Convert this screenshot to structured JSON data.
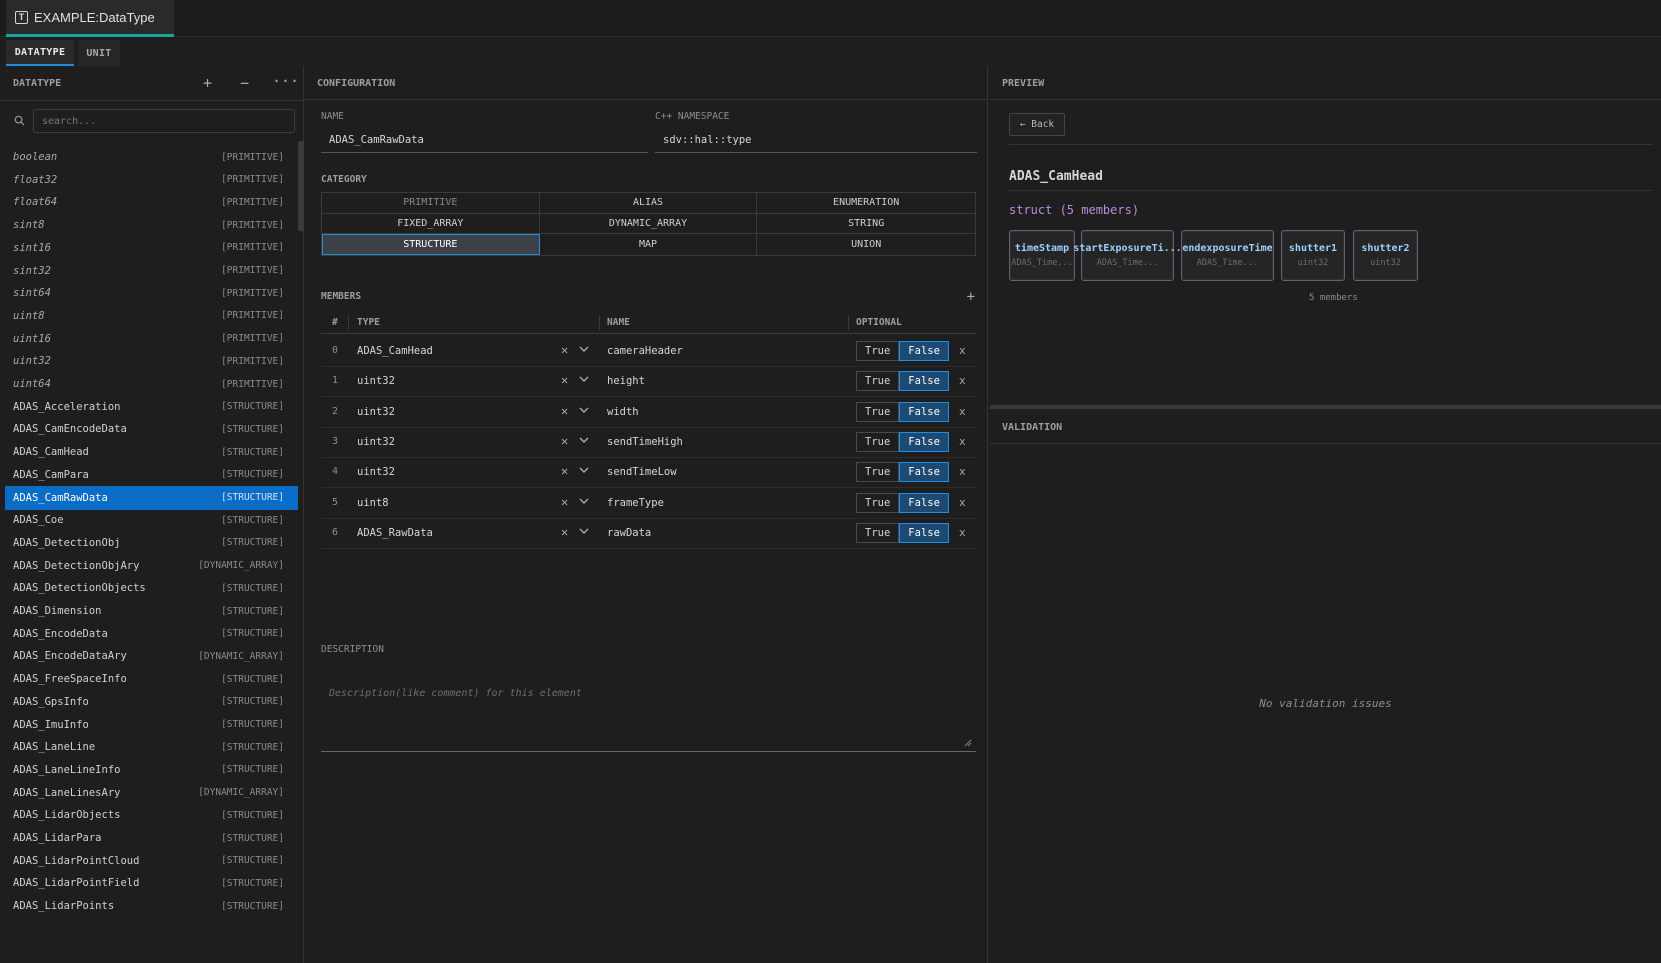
{
  "window": {
    "tab_title": "EXAMPLE:DataType",
    "tab_icon": "type-icon"
  },
  "tabs": [
    {
      "label": "DATATYPE"
    },
    {
      "label": "UNIT"
    }
  ],
  "sidebar": {
    "title": "DATATYPE",
    "add_label": "+",
    "remove_label": "−",
    "more_label": "···",
    "search_placeholder": "search...",
    "items": [
      {
        "name": "boolean",
        "tag": "[PRIMITIVE]"
      },
      {
        "name": "float32",
        "tag": "[PRIMITIVE]"
      },
      {
        "name": "float64",
        "tag": "[PRIMITIVE]"
      },
      {
        "name": "sint8",
        "tag": "[PRIMITIVE]"
      },
      {
        "name": "sint16",
        "tag": "[PRIMITIVE]"
      },
      {
        "name": "sint32",
        "tag": "[PRIMITIVE]"
      },
      {
        "name": "sint64",
        "tag": "[PRIMITIVE]"
      },
      {
        "name": "uint8",
        "tag": "[PRIMITIVE]"
      },
      {
        "name": "uint16",
        "tag": "[PRIMITIVE]"
      },
      {
        "name": "uint32",
        "tag": "[PRIMITIVE]"
      },
      {
        "name": "uint64",
        "tag": "[PRIMITIVE]"
      },
      {
        "name": "ADAS_Acceleration",
        "tag": "[STRUCTURE]"
      },
      {
        "name": "ADAS_CamEncodeData",
        "tag": "[STRUCTURE]"
      },
      {
        "name": "ADAS_CamHead",
        "tag": "[STRUCTURE]"
      },
      {
        "name": "ADAS_CamPara",
        "tag": "[STRUCTURE]"
      },
      {
        "name": "ADAS_CamRawData",
        "tag": "[STRUCTURE]"
      },
      {
        "name": "ADAS_Coe",
        "tag": "[STRUCTURE]"
      },
      {
        "name": "ADAS_DetectionObj",
        "tag": "[STRUCTURE]"
      },
      {
        "name": "ADAS_DetectionObjAry",
        "tag": "[DYNAMIC_ARRAY]"
      },
      {
        "name": "ADAS_DetectionObjects",
        "tag": "[STRUCTURE]"
      },
      {
        "name": "ADAS_Dimension",
        "tag": "[STRUCTURE]"
      },
      {
        "name": "ADAS_EncodeData",
        "tag": "[STRUCTURE]"
      },
      {
        "name": "ADAS_EncodeDataAry",
        "tag": "[DYNAMIC_ARRAY]"
      },
      {
        "name": "ADAS_FreeSpaceInfo",
        "tag": "[STRUCTURE]"
      },
      {
        "name": "ADAS_GpsInfo",
        "tag": "[STRUCTURE]"
      },
      {
        "name": "ADAS_ImuInfo",
        "tag": "[STRUCTURE]"
      },
      {
        "name": "ADAS_LaneLine",
        "tag": "[STRUCTURE]"
      },
      {
        "name": "ADAS_LaneLineInfo",
        "tag": "[STRUCTURE]"
      },
      {
        "name": "ADAS_LaneLinesAry",
        "tag": "[DYNAMIC_ARRAY]"
      },
      {
        "name": "ADAS_LidarObjects",
        "tag": "[STRUCTURE]"
      },
      {
        "name": "ADAS_LidarPara",
        "tag": "[STRUCTURE]"
      },
      {
        "name": "ADAS_LidarPointCloud",
        "tag": "[STRUCTURE]"
      },
      {
        "name": "ADAS_LidarPointField",
        "tag": "[STRUCTURE]"
      },
      {
        "name": "ADAS_LidarPoints",
        "tag": "[STRUCTURE]"
      }
    ]
  },
  "config": {
    "title": "CONFIGURATION",
    "name_label": "NAME",
    "name_value": "ADAS_CamRawData",
    "namespace_label": "C++ NAMESPACE",
    "namespace_value": "sdv::hal::type",
    "category_label": "CATEGORY",
    "categories": [
      {
        "label": "PRIMITIVE",
        "state": "disabled"
      },
      {
        "label": "ALIAS",
        "state": "normal"
      },
      {
        "label": "ENUMERATION",
        "state": "normal"
      },
      {
        "label": "FIXED_ARRAY",
        "state": "normal"
      },
      {
        "label": "DYNAMIC_ARRAY",
        "state": "normal"
      },
      {
        "label": "STRING",
        "state": "normal"
      },
      {
        "label": "STRUCTURE",
        "state": "selected"
      },
      {
        "label": "MAP",
        "state": "normal"
      },
      {
        "label": "UNION",
        "state": "normal"
      }
    ],
    "members_label": "MEMBERS",
    "members_add": "+",
    "columns": {
      "index": "#",
      "type": "TYPE",
      "name": "NAME",
      "optional": "OPTIONAL"
    },
    "members": [
      {
        "index": "0",
        "type": "ADAS_CamHead",
        "name": "cameraHeader",
        "true_label": "True",
        "false_label": "False"
      },
      {
        "index": "1",
        "type": "uint32",
        "name": "height",
        "true_label": "True",
        "false_label": "False"
      },
      {
        "index": "2",
        "type": "uint32",
        "name": "width",
        "true_label": "True",
        "false_label": "False"
      },
      {
        "index": "3",
        "type": "uint32",
        "name": "sendTimeHigh",
        "true_label": "True",
        "false_label": "False"
      },
      {
        "index": "4",
        "type": "uint32",
        "name": "sendTimeLow",
        "true_label": "True",
        "false_label": "False"
      },
      {
        "index": "5",
        "type": "uint8",
        "name": "frameType",
        "true_label": "True",
        "false_label": "False"
      },
      {
        "index": "6",
        "type": "ADAS_RawData",
        "name": "rawData",
        "true_label": "True",
        "false_label": "False"
      }
    ],
    "description_label": "DESCRIPTION",
    "description_placeholder": "Description(like comment) for this element"
  },
  "preview": {
    "title": "PREVIEW",
    "back_label": "← Back",
    "type_name": "ADAS_CamHead",
    "struct_summary": "struct (5 members)",
    "chips": [
      {
        "name": "timeStamp",
        "type": "ADAS_Time..."
      },
      {
        "name": "startExposureTi...",
        "type": "ADAS_Time..."
      },
      {
        "name": "endexposureTime",
        "type": "ADAS_Time..."
      },
      {
        "name": "shutter1",
        "type": "uint32"
      },
      {
        "name": "shutter2",
        "type": "uint32"
      }
    ],
    "member_count": "5 members"
  },
  "validation": {
    "title": "VALIDATION",
    "empty_message": "No validation issues"
  }
}
